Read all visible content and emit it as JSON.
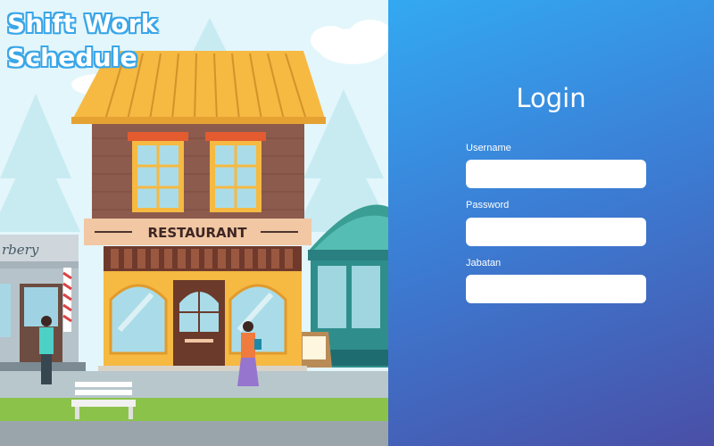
{
  "app": {
    "title_line1": "Shift Work",
    "title_line2": "Schedule"
  },
  "illustration": {
    "restaurant_sign": "RESTAURANT",
    "barber_sign": "rbery"
  },
  "login": {
    "title": "Login",
    "username_label": "Username",
    "username_value": "",
    "password_label": "Password",
    "password_value": "",
    "jabatan_label": "Jabatan",
    "jabatan_value": ""
  },
  "colors": {
    "title_outline": "#3aa6e8",
    "panel_gradient_top": "#33a9f2",
    "panel_gradient_bottom": "#4a4fa6"
  }
}
